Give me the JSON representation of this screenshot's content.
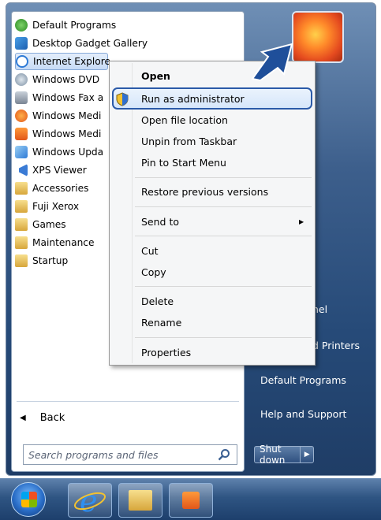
{
  "programs": [
    {
      "label": "Default Programs",
      "icon": "default-programs-icon"
    },
    {
      "label": "Desktop Gadget Gallery",
      "icon": "gadget-icon"
    },
    {
      "label": "Internet Explore",
      "icon": "ie-icon"
    },
    {
      "label": "Windows DVD",
      "icon": "dvd-icon"
    },
    {
      "label": "Windows Fax a",
      "icon": "fax-icon"
    },
    {
      "label": "Windows Medi",
      "icon": "media-icon"
    },
    {
      "label": "Windows Medi",
      "icon": "media-center-icon"
    },
    {
      "label": "Windows Upda",
      "icon": "update-icon"
    },
    {
      "label": "XPS Viewer",
      "icon": "xps-icon"
    },
    {
      "label": "Accessories",
      "icon": "folder-icon"
    },
    {
      "label": "Fuji Xerox",
      "icon": "folder-icon"
    },
    {
      "label": "Games",
      "icon": "folder-icon"
    },
    {
      "label": "Maintenance",
      "icon": "folder-icon"
    },
    {
      "label": "Startup",
      "icon": "folder-icon"
    }
  ],
  "back_label": "Back",
  "search_placeholder": "Search programs and files",
  "right_items": [
    "nel",
    "d Printers",
    "Default Programs",
    "Help and Support"
  ],
  "shutdown_label": "Shut down",
  "context_menu": {
    "open": "Open",
    "run_as_admin": "Run as administrator",
    "open_location": "Open file location",
    "unpin_taskbar": "Unpin from Taskbar",
    "pin_start": "Pin to Start Menu",
    "restore_versions": "Restore previous versions",
    "send_to": "Send to",
    "cut": "Cut",
    "copy": "Copy",
    "delete": "Delete",
    "rename": "Rename",
    "properties": "Properties"
  },
  "colors": {
    "highlight_border": "#2b5aa8",
    "arrow": "#1f4f9a",
    "start_menu_blue": "#264a78"
  }
}
